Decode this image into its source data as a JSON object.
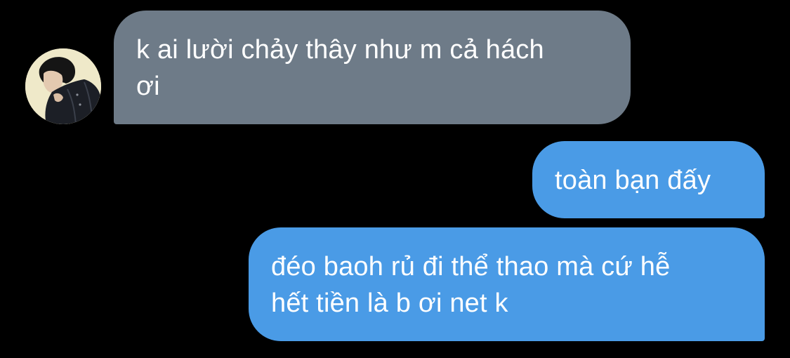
{
  "conversation": {
    "incoming": {
      "avatar_icon": "user-photo-avatar",
      "lines": [
        "k ai lười chảy thây như m cả hách",
        "ơi"
      ]
    },
    "outgoing_1": {
      "lines": [
        "toàn bạn đấy"
      ]
    },
    "outgoing_2": {
      "lines": [
        "đéo baoh rủ đi thể thao mà cứ hễ",
        "hết tiền là b ơi net k"
      ]
    }
  },
  "colors": {
    "background": "#000000",
    "incoming_bubble": "#6e7b88",
    "outgoing_bubble": "#4a9be6",
    "text": "#ffffff"
  }
}
